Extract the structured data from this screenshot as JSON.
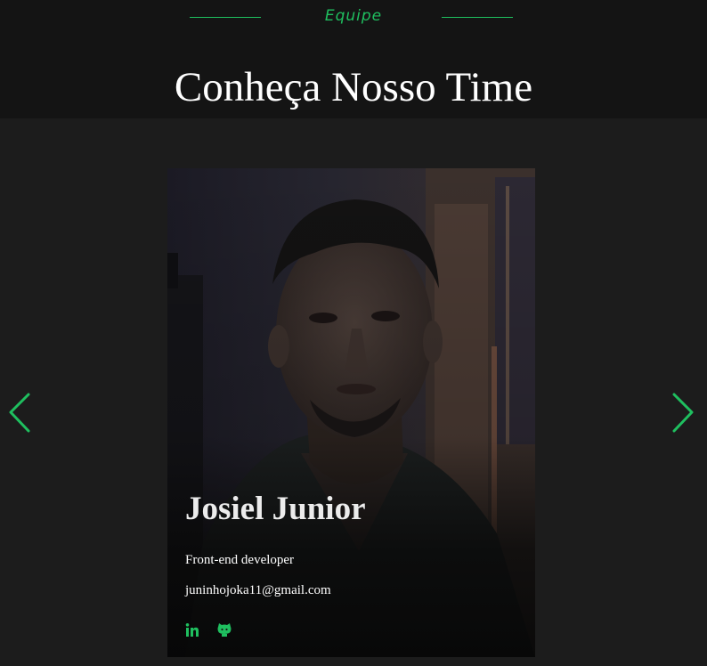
{
  "section": {
    "eyebrow": "Equipe",
    "title": "Conheça Nosso Time"
  },
  "member": {
    "name": "Josiel Junior",
    "role": "Front-end developer",
    "email": "juninhojoka11@gmail.com",
    "photo": "profile-photo"
  },
  "social": {
    "linkedin_icon": "linkedin-icon",
    "github_icon": "github-icon"
  },
  "carousel": {
    "prev_icon": "chevron-left-icon",
    "next_icon": "chevron-right-icon"
  },
  "colors": {
    "accent": "#1fbf5f",
    "background": "#1c1c1c",
    "header_background": "#141414",
    "text": "#ffffff"
  }
}
